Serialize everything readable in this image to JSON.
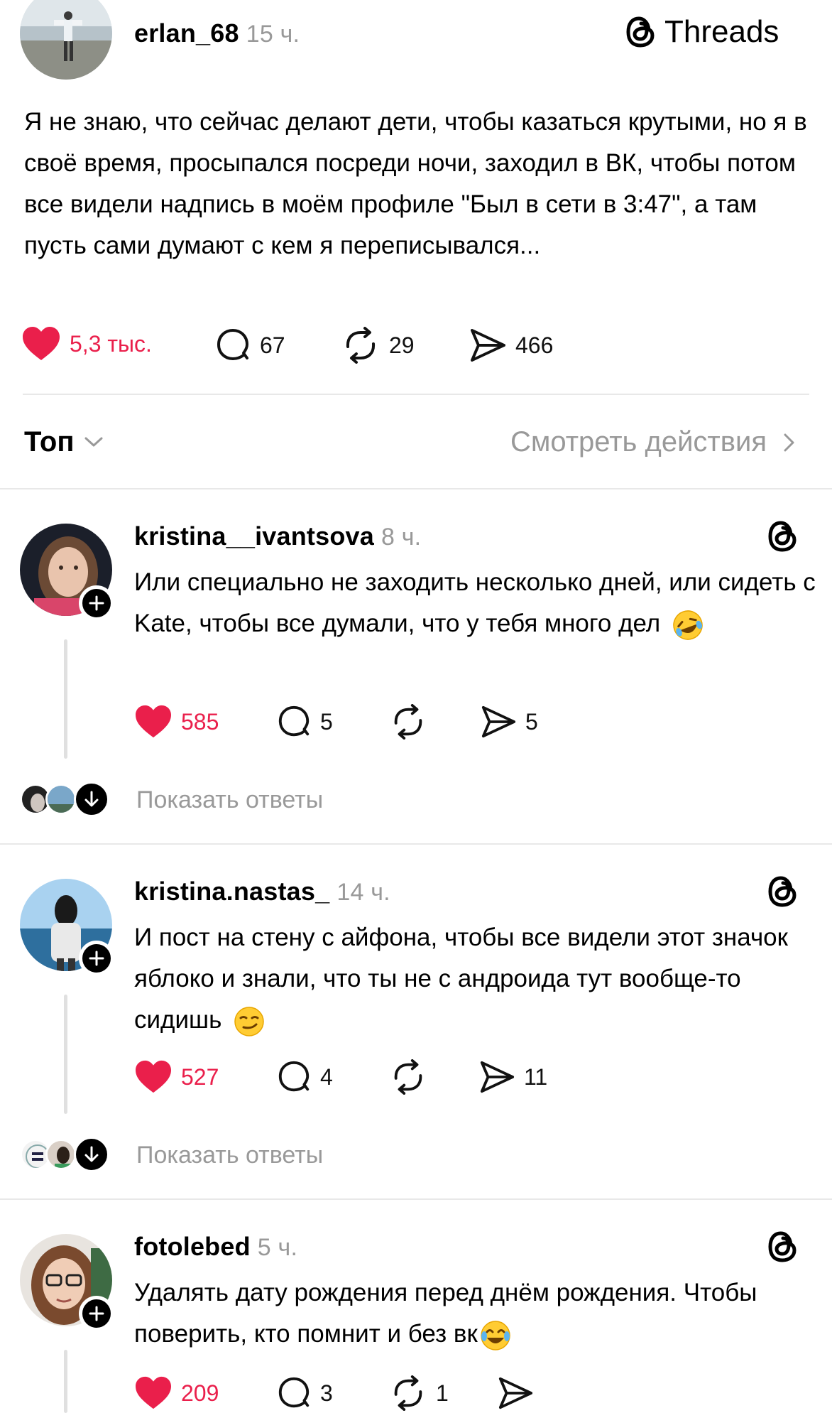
{
  "post": {
    "username": "erlan_68",
    "time": "15 ч.",
    "brand": "Threads",
    "text": "Я не знаю, что сейчас делают дети, чтобы казаться крутыми, но я в своё время, просыпался посреди ночи, заходил в ВК, чтобы потом все видели надпись в моём профиле \"Был в сети в 3:47\", а там пусть сами думают с кем я переписывался...",
    "likes": "5,3 тыс.",
    "comments": "67",
    "reposts": "29",
    "shares": "466"
  },
  "sort": {
    "label": "Топ",
    "activity_link": "Смотреть действия"
  },
  "replies": [
    {
      "username": "kristina__ivantsova",
      "time": "8 ч.",
      "text": "Или специально не заходить несколько дней, или сидеть с Kate, чтобы все думали, что у тебя много дел",
      "emoji": "rofl-emoji",
      "likes": "585",
      "comments": "5",
      "reposts": "",
      "shares": "5",
      "show_replies": "Показать ответы"
    },
    {
      "username": "kristina.nastas_",
      "time": "14 ч.",
      "text": "И пост на стену с айфона, чтобы все видели этот значок яблоко и знали, что ты не с андроида тут вообще-то сидишь",
      "emoji": "smirk-emoji",
      "likes": "527",
      "comments": "4",
      "reposts": "",
      "shares": "11",
      "show_replies": "Показать ответы"
    },
    {
      "username": "fotolebed",
      "time": "5 ч.",
      "text": "Удалять дату рождения перед днём рождения. Чтобы поверить, кто помнит и без вк",
      "emoji": "joy-emoji",
      "likes": "209",
      "comments": "3",
      "reposts": "1",
      "shares": ""
    }
  ],
  "colors": {
    "like_red": "#ea1f4b",
    "muted_gray": "#999999",
    "divider": "#e8e8e8"
  }
}
